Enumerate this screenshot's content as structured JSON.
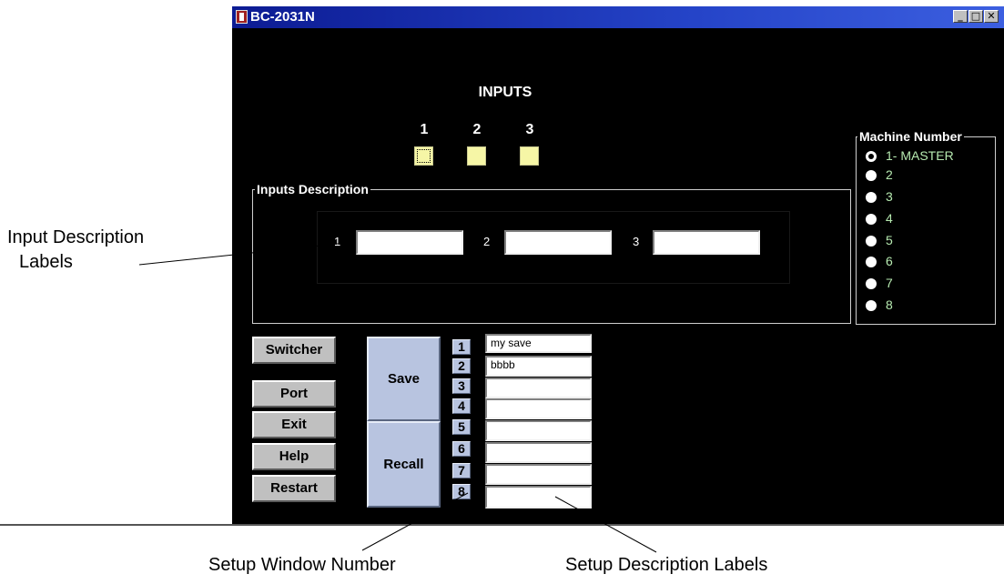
{
  "window": {
    "title": "BC-2031N",
    "minimize_glyph": "_",
    "maximize_glyph": "□",
    "close_glyph": "✕"
  },
  "inputs": {
    "heading": "INPUTS",
    "numbers": [
      "1",
      "2",
      "3"
    ],
    "selected_index": 0
  },
  "inputs_description": {
    "label": "Inputs Description",
    "fields": [
      {
        "number": "1",
        "value": ""
      },
      {
        "number": "2",
        "value": ""
      },
      {
        "number": "3",
        "value": ""
      }
    ]
  },
  "machine_number": {
    "label": "Machine Number",
    "options": [
      "1- MASTER",
      "2",
      "3",
      "4",
      "5",
      "6",
      "7",
      "8"
    ],
    "selected_index": 0
  },
  "commands": [
    "Switcher",
    "Port",
    "Exit",
    "Help",
    "Restart"
  ],
  "setup": {
    "save_label": "Save",
    "recall_label": "Recall",
    "slot_numbers": [
      "1",
      "2",
      "3",
      "4",
      "5",
      "6",
      "7",
      "8"
    ],
    "slot_descriptions": [
      "my save",
      "bbbb",
      "",
      "",
      "",
      "",
      "",
      ""
    ]
  },
  "annotations": {
    "input_description_labels_line1": "Input Description",
    "input_description_labels_line2": "Labels",
    "setup_window_number": "Setup Window Number",
    "setup_description_labels": "Setup Description Labels"
  },
  "colors": {
    "window_background": "#000000",
    "titlebar": "#0c1b93",
    "input_button": "#f6f6a6",
    "setup_button": "#b8c4e0",
    "radio_label": "#b6eab0"
  }
}
